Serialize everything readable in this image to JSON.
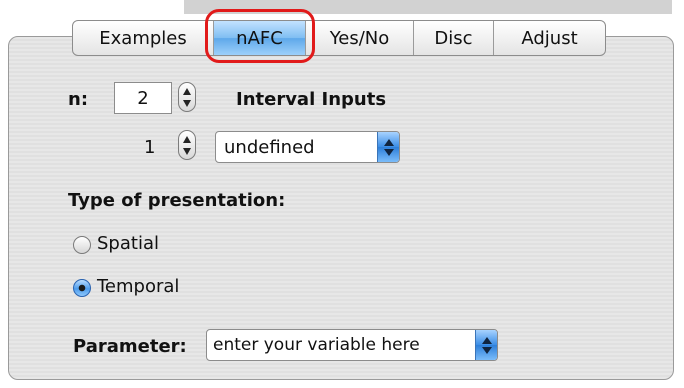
{
  "tabs": [
    {
      "label": "Examples",
      "selected": false
    },
    {
      "label": "nAFC",
      "selected": true
    },
    {
      "label": "Yes/No",
      "selected": false
    },
    {
      "label": "Disc",
      "selected": false
    },
    {
      "label": "Adjust",
      "selected": false
    }
  ],
  "n_label": "n:",
  "n_value": "2",
  "interval_inputs_label": "Interval Inputs",
  "interval_index": "1",
  "interval_popup_value": "undefined",
  "presentation_label": "Type of presentation:",
  "radios": [
    {
      "label": "Spatial",
      "selected": false
    },
    {
      "label": "Temporal",
      "selected": true
    }
  ],
  "parameter_label": "Parameter:",
  "parameter_value": "enter your variable here",
  "colors": {
    "selected_tab": "#7fbef2",
    "highlight": "#e11a1a",
    "popup_arrow": "#3a8de6"
  }
}
